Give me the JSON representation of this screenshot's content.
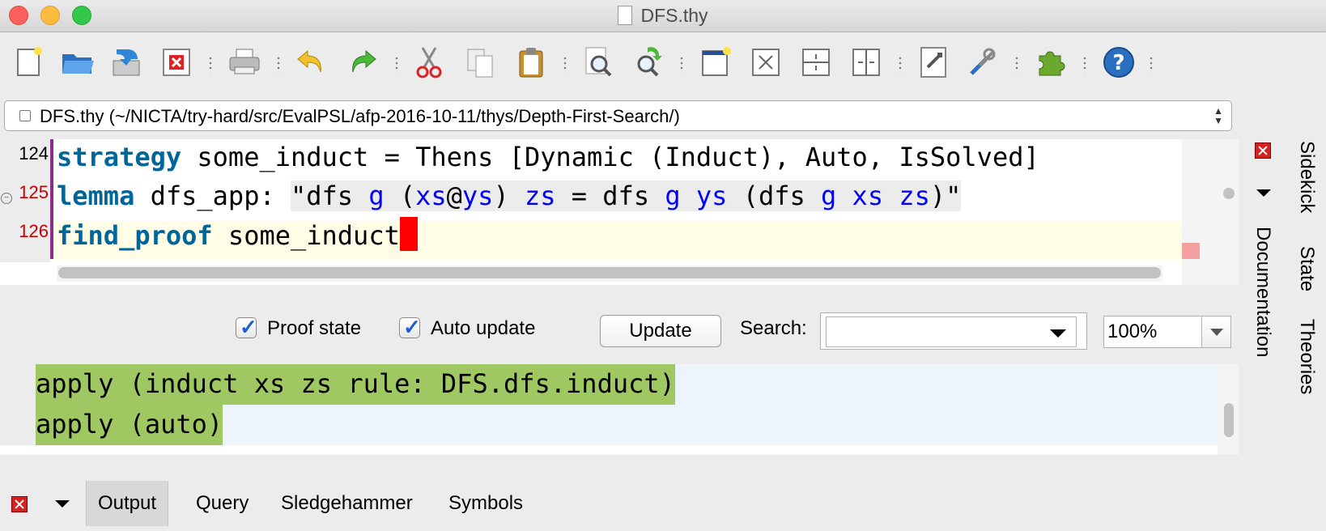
{
  "window": {
    "title": "DFS.thy"
  },
  "toolbar": {
    "buttons": [
      {
        "name": "new-file-icon"
      },
      {
        "name": "open-folder-icon"
      },
      {
        "name": "save-icon"
      },
      {
        "name": "close-buffer-icon"
      },
      {
        "name": "print-icon"
      },
      {
        "name": "undo-icon"
      },
      {
        "name": "redo-icon"
      },
      {
        "name": "cut-icon"
      },
      {
        "name": "copy-icon"
      },
      {
        "name": "paste-icon"
      },
      {
        "name": "find-icon"
      },
      {
        "name": "find-replace-icon"
      },
      {
        "name": "new-view-icon"
      },
      {
        "name": "unsplit-icon"
      },
      {
        "name": "split-horizontal-icon"
      },
      {
        "name": "split-vertical-icon"
      },
      {
        "name": "buffer-options-icon"
      },
      {
        "name": "global-options-icon"
      },
      {
        "name": "plugin-manager-icon"
      },
      {
        "name": "help-icon"
      }
    ]
  },
  "buffer": {
    "path": "DFS.thy (~/NICTA/try-hard/src/EvalPSL/afp-2016-10-11/thys/Depth-First-Search/)"
  },
  "editor": {
    "lines": [
      {
        "number": "124",
        "kw": "strategy",
        "rest": " some_induct = Thens [Dynamic (Induct), Auto, IsSolved]"
      },
      {
        "number": "125",
        "kw": "lemma",
        "rest": " dfs_app: "
      },
      {
        "number": "126",
        "kw": "find_proof",
        "rest": " some_induct"
      }
    ],
    "lemma_str": {
      "q1": "\"dfs ",
      "g1": "g",
      "sp1": " (",
      "xs1": "xs",
      "at": "@",
      "ys1": "ys",
      "sp2": ") ",
      "zs1": "zs",
      "eq": " = dfs ",
      "g2": "g",
      "sp3": " ",
      "ys2": "ys",
      "sp4": " (dfs ",
      "g3": "g",
      "sp5": " ",
      "xs2": "xs",
      "sp6": " ",
      "zs2": "zs",
      "q2": ")\""
    }
  },
  "controls": {
    "proof_state": "Proof state",
    "auto_update": "Auto update",
    "update_button": "Update",
    "search_label": "Search:",
    "search_value": "",
    "zoom": "100%"
  },
  "output": {
    "lines": [
      "apply (induct xs zs rule: DFS.dfs.induct)",
      "apply (auto)"
    ]
  },
  "bottom_tabs": [
    "Output",
    "Query",
    "Sledgehammer",
    "Symbols"
  ],
  "side_tabs": [
    "Sidekick",
    "State",
    "Theories",
    "Documentation"
  ],
  "colors": {
    "keyword": "#006699",
    "free_var": "#0000ff",
    "output_highlight": "#a0c862",
    "cursor": "#ff0000",
    "line_numbers": "#cc0000"
  }
}
